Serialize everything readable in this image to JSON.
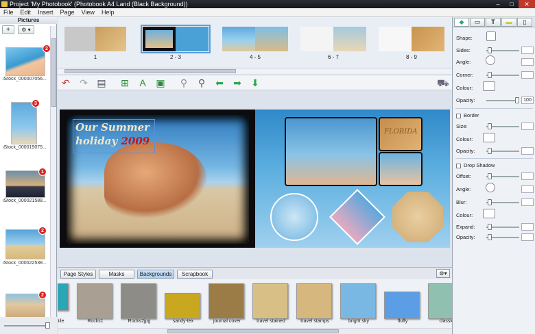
{
  "window": {
    "title": "Project 'My Photobook' (Photobook A4 Land (Black Background))",
    "minimize": "–",
    "maximize": "□",
    "close": "✕"
  },
  "menu": [
    "File",
    "Edit",
    "Insert",
    "Page",
    "View",
    "Help"
  ],
  "pictures_panel": {
    "title": "Pictures",
    "add_label": "+",
    "options_label": "⚙ ▾",
    "items": [
      {
        "caption": "iStock_000007056...",
        "badge": "2"
      },
      {
        "caption": "iStock_000019075...",
        "badge": "3"
      },
      {
        "caption": "iStock_000021588...",
        "badge": "1"
      },
      {
        "caption": "iStock_000022538...",
        "badge": "2"
      },
      {
        "caption": "",
        "badge": "2"
      }
    ]
  },
  "spreads": [
    {
      "label": "1"
    },
    {
      "label": "2 - 3"
    },
    {
      "label": "4 - 5"
    },
    {
      "label": "6 - 7"
    },
    {
      "label": "8 - 9"
    }
  ],
  "page_text": {
    "line1": "Our Summer",
    "line2": "holiday",
    "year": "2009"
  },
  "sand_text": "FLORIDA",
  "tabs": [
    "Page Styles",
    "Masks",
    "Backgrounds",
    "Scrapbook"
  ],
  "active_tab": "Backgrounds",
  "backgrounds": [
    {
      "name": "tile",
      "color": "#2aa6b6"
    },
    {
      "name": "Rocks1",
      "color": "#a99f92"
    },
    {
      "name": "Rocks2jpg",
      "color": "#8d8c86"
    },
    {
      "name": "sandy-tex",
      "color": "#c9a820"
    },
    {
      "name": "journal cover",
      "color": "#9c7c46"
    },
    {
      "name": "travel stained",
      "color": "#d8bf86"
    },
    {
      "name": "travel stamps",
      "color": "#d6b77e"
    },
    {
      "name": "bright sky",
      "color": "#78b8e3"
    },
    {
      "name": "fluffy",
      "color": "#5b9ee6"
    },
    {
      "name": "classic",
      "color": "#8fc0b0"
    }
  ],
  "properties": {
    "shape_label": "Shape:",
    "sides_label": "Sides:",
    "angle_label": "Angle:",
    "corner_label": "Corner:",
    "colour_label": "Colour:",
    "opacity_label": "Opacity:",
    "opacity_value": "100",
    "border_label": "Border",
    "size_label": "Size:",
    "border_colour_label": "Colour:",
    "border_opacity_label": "Opacity:",
    "shadow_label": "Drop Shadow",
    "offset_label": "Offset:",
    "shadow_angle_label": "Angle:",
    "blur_label": "Blur:",
    "shadow_colour_label": "Colour:",
    "expand_label": "Expand:",
    "shadow_opacity_label": "Opacity:"
  }
}
